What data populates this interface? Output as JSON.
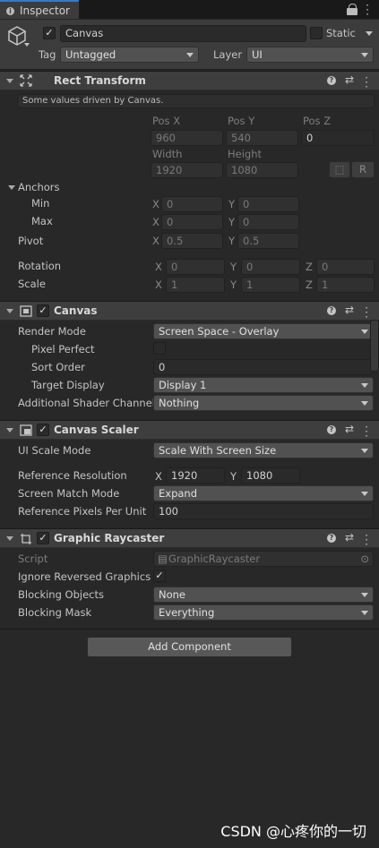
{
  "tab": {
    "label": "Inspector"
  },
  "object": {
    "name": "Canvas",
    "static_label": "Static",
    "tag_label": "Tag",
    "tag_value": "Untagged",
    "layer_label": "Layer",
    "layer_value": "UI"
  },
  "rect_transform": {
    "title": "Rect Transform",
    "note": "Some values driven by Canvas.",
    "pos_x_label": "Pos X",
    "pos_y_label": "Pos Y",
    "pos_z_label": "Pos Z",
    "pos_x": "960",
    "pos_y": "540",
    "pos_z": "0",
    "width_label": "Width",
    "height_label": "Height",
    "width": "1920",
    "height": "1080",
    "r_button": "R",
    "anchors_label": "Anchors",
    "min_label": "Min",
    "max_label": "Max",
    "min_x": "0",
    "min_y": "0",
    "max_x": "0",
    "max_y": "0",
    "pivot_label": "Pivot",
    "pivot_x": "0.5",
    "pivot_y": "0.5",
    "rotation_label": "Rotation",
    "rot_x": "0",
    "rot_y": "0",
    "rot_z": "0",
    "scale_label": "Scale",
    "scale_x": "1",
    "scale_y": "1",
    "scale_z": "1",
    "x": "X",
    "y": "Y",
    "z": "Z"
  },
  "canvas": {
    "title": "Canvas",
    "render_mode_label": "Render Mode",
    "render_mode": "Screen Space - Overlay",
    "pixel_perfect_label": "Pixel Perfect",
    "sort_order_label": "Sort Order",
    "sort_order": "0",
    "target_display_label": "Target Display",
    "target_display": "Display 1",
    "shader_channel_label": "Additional Shader Channel",
    "shader_channel": "Nothing"
  },
  "canvas_scaler": {
    "title": "Canvas Scaler",
    "ui_scale_mode_label": "UI Scale Mode",
    "ui_scale_mode": "Scale With Screen Size",
    "ref_res_label": "Reference Resolution",
    "ref_x": "1920",
    "ref_y": "1080",
    "match_mode_label": "Screen Match Mode",
    "match_mode": "Expand",
    "ref_ppu_label": "Reference Pixels Per Unit",
    "ref_ppu": "100"
  },
  "raycaster": {
    "title": "Graphic Raycaster",
    "script_label": "Script",
    "script_value": "GraphicRaycaster",
    "ignore_reversed_label": "Ignore Reversed Graphics",
    "blocking_objects_label": "Blocking Objects",
    "blocking_objects": "None",
    "blocking_mask_label": "Blocking Mask",
    "blocking_mask": "Everything"
  },
  "add_component": "Add Component",
  "watermark": "CSDN @心疼你的一切",
  "colors": {
    "accent": "#3a79bb",
    "panel": "#282828",
    "header": "#3e3e3e"
  }
}
